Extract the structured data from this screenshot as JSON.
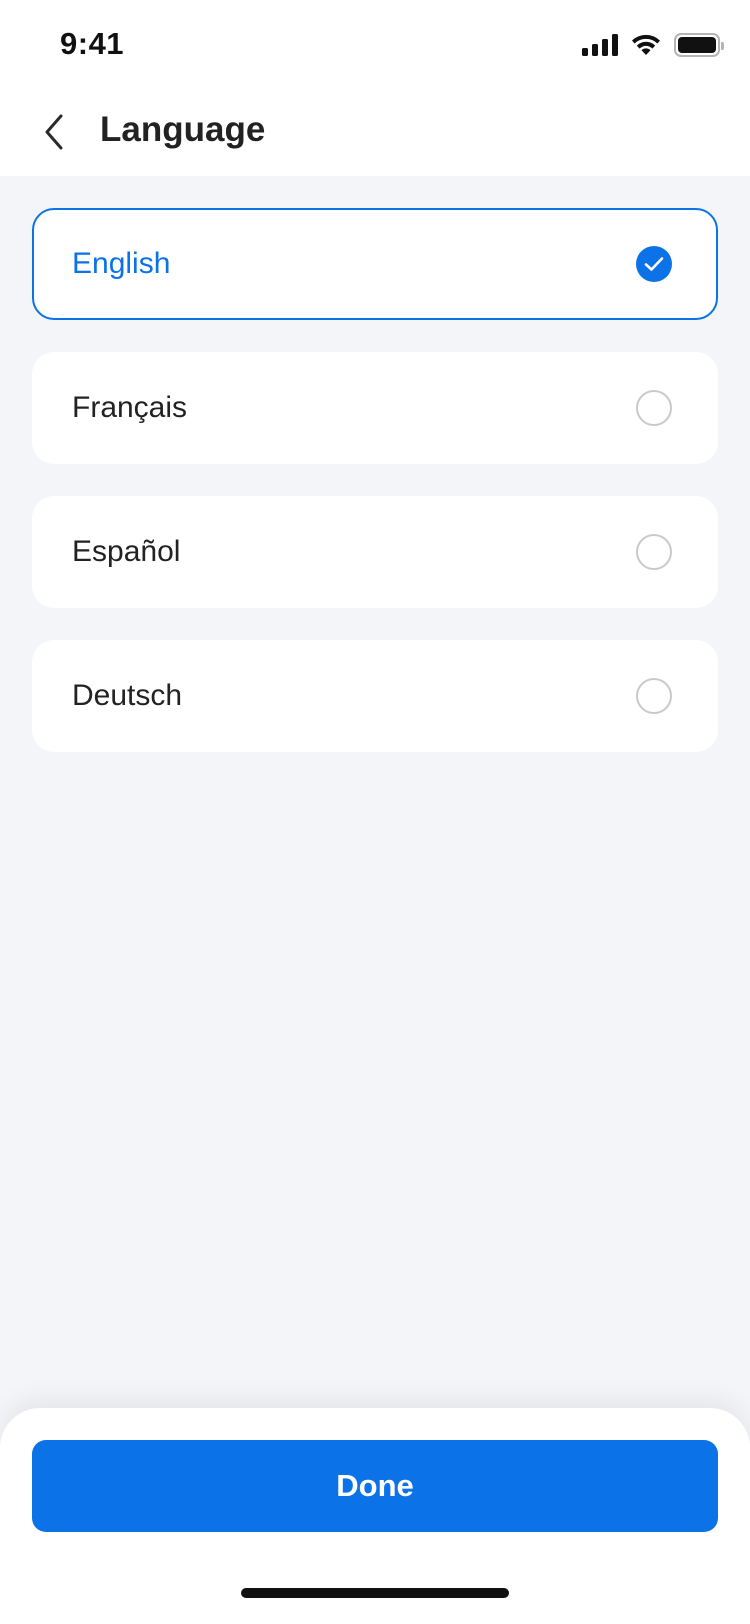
{
  "status_bar": {
    "time": "9:41",
    "icons": [
      "cellular-signal-icon",
      "wifi-icon",
      "battery-icon"
    ]
  },
  "header": {
    "back_icon": "chevron-left-icon",
    "title": "Language"
  },
  "languages": [
    {
      "label": "English",
      "selected": true
    },
    {
      "label": "Français",
      "selected": false
    },
    {
      "label": "Español",
      "selected": false
    },
    {
      "label": "Deutsch",
      "selected": false
    }
  ],
  "actions": {
    "done_label": "Done"
  },
  "colors": {
    "accent": "#0b72e7",
    "background": "#f3f5f9",
    "card": "#ffffff",
    "radio_border": "#c9c9c9"
  }
}
